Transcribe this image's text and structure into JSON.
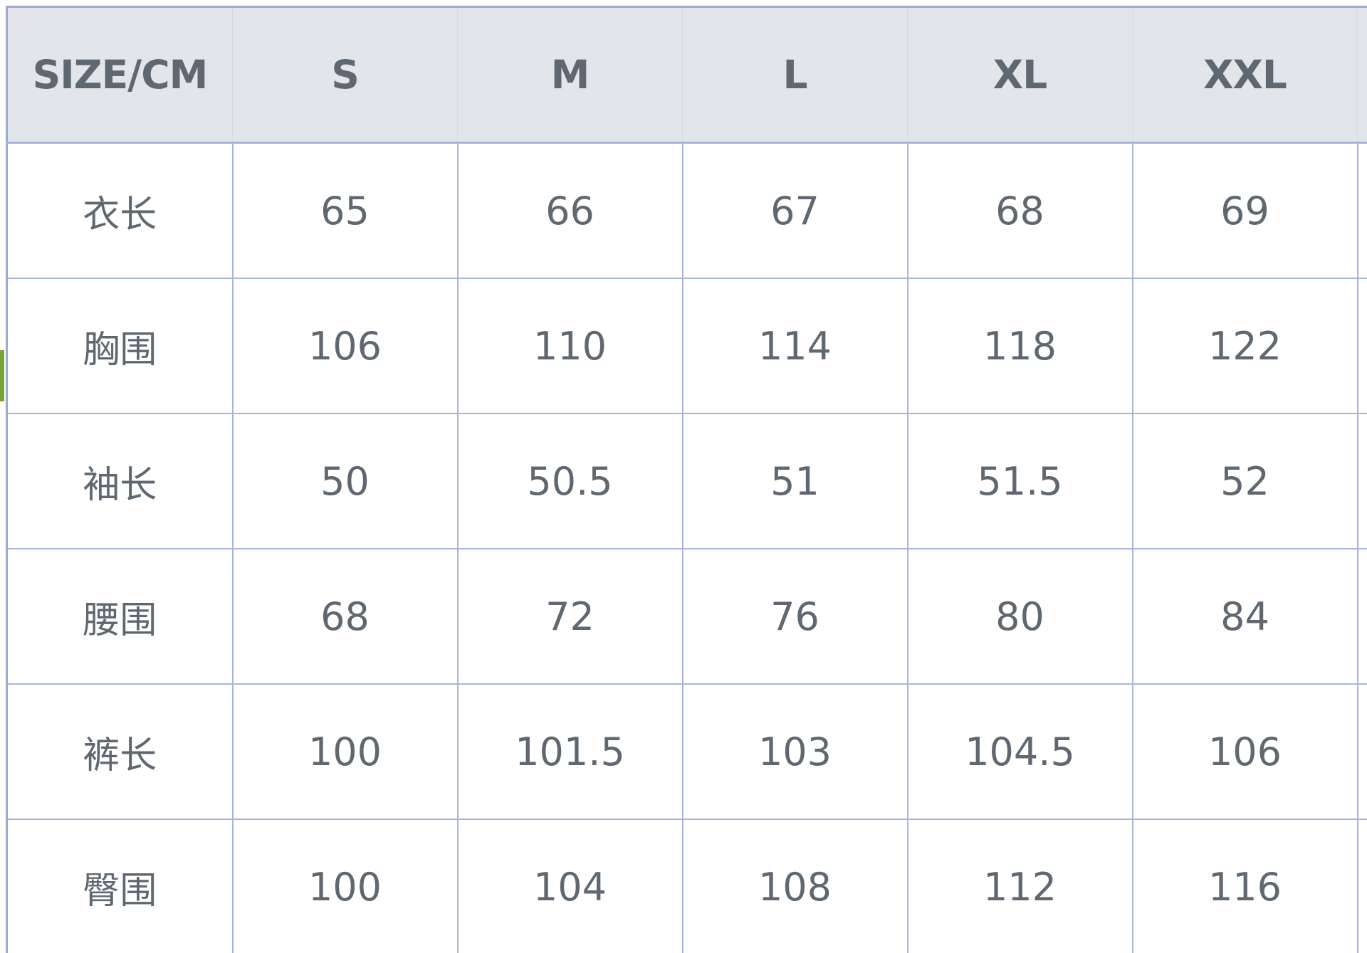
{
  "table": {
    "header": [
      "SIZE/CM",
      "S",
      "M",
      "L",
      "XL",
      "XXL"
    ],
    "rows": [
      {
        "label": "衣长",
        "values": [
          "65",
          "66",
          "67",
          "68",
          "69"
        ]
      },
      {
        "label": "胸围",
        "values": [
          "106",
          "110",
          "114",
          "118",
          "122"
        ]
      },
      {
        "label": "袖长",
        "values": [
          "50",
          "50.5",
          "51",
          "51.5",
          "52"
        ]
      },
      {
        "label": "腰围",
        "values": [
          "68",
          "72",
          "76",
          "80",
          "84"
        ]
      },
      {
        "label": "裤长",
        "values": [
          "100",
          "101.5",
          "103",
          "104.5",
          "106"
        ]
      },
      {
        "label": "臀围",
        "values": [
          "100",
          "104",
          "108",
          "112",
          "116"
        ]
      }
    ]
  },
  "colors": {
    "header_bg": "#e2e5e9",
    "grid_line": "#a9b4dd",
    "text": "#5f6870",
    "accent": "#7aa33a"
  }
}
